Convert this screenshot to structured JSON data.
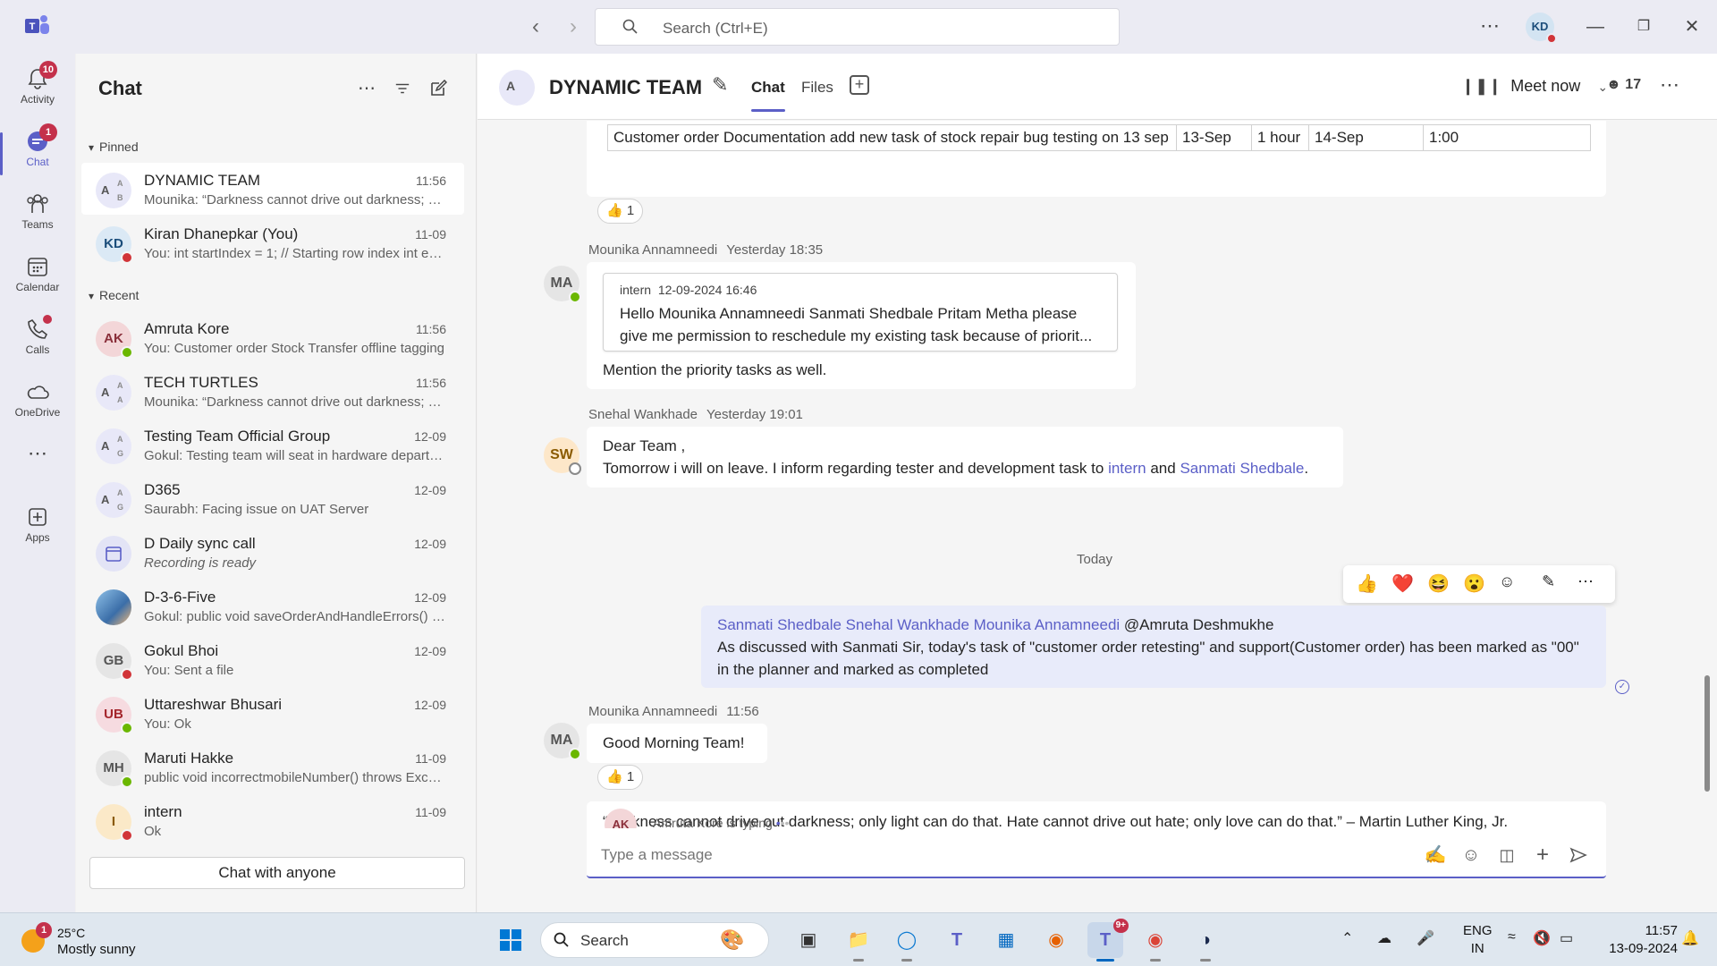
{
  "titlebar": {
    "search_placeholder": "Search (Ctrl+E)",
    "user_initials": "KD",
    "more_label": "⋯"
  },
  "rail": {
    "items": [
      {
        "label": "Activity",
        "badge": "10"
      },
      {
        "label": "Chat",
        "badge": "1"
      },
      {
        "label": "Teams"
      },
      {
        "label": "Calendar"
      },
      {
        "label": "Calls"
      },
      {
        "label": "OneDrive"
      },
      {
        "label": "Apps"
      }
    ]
  },
  "chatlist": {
    "title": "Chat",
    "pinned_label": "Pinned",
    "recent_label": "Recent",
    "chat_with_anyone": "Chat with anyone",
    "pinned": [
      {
        "name": "DYNAMIC TEAM",
        "time": "11:56",
        "preview": "Mounika: “Darkness cannot drive out darkness; only light can do that.",
        "initials": "A"
      },
      {
        "name": "Kiran Dhanepkar (You)",
        "time": "11-09",
        "preview": "You: int startIndex = 1; // Starting row index int endIndex",
        "initials": "KD"
      }
    ],
    "recent": [
      {
        "name": "Amruta Kore",
        "time": "11:56",
        "preview": "You: Customer order Stock Transfer offline tagging",
        "initials": "AK"
      },
      {
        "name": "TECH TURTLES",
        "time": "11:56",
        "preview": "Mounika: “Darkness cannot drive out darkness; only light",
        "initials": "A"
      },
      {
        "name": "Testing Team Official Group",
        "time": "12-09",
        "preview": "Gokul: Testing team will seat in hardware department",
        "initials": "A"
      },
      {
        "name": "D365",
        "time": "12-09",
        "preview": "Saurabh: Facing issue on UAT Server",
        "initials": "A"
      },
      {
        "name": "D Daily sync call",
        "time": "12-09",
        "preview": "Recording is ready"
      },
      {
        "name": "D-3-6-Five",
        "time": "12-09",
        "preview": "Gokul: public void saveOrderAndHandleErrors() throws"
      },
      {
        "name": "Gokul Bhoi",
        "time": "12-09",
        "preview": "You: Sent a file",
        "initials": "GB"
      },
      {
        "name": "Uttareshwar Bhusari",
        "time": "12-09",
        "preview": "You: Ok",
        "initials": "UB"
      },
      {
        "name": "Maruti Hakke",
        "time": "11-09",
        "preview": "public void incorrectmobileNumber() throws Exception",
        "initials": "MH"
      },
      {
        "name": "intern",
        "time": "11-09",
        "preview": "Ok",
        "initials": "I"
      }
    ]
  },
  "header": {
    "title": "DYNAMIC TEAM",
    "avatar_initials": "A",
    "tabs": [
      "Chat",
      "Files"
    ],
    "meet_now": "Meet now",
    "participants": "17"
  },
  "messages": {
    "table_row": [
      "Customer order Documentation add new task of stock repair bug testing on 13 sep",
      "13-Sep",
      "1 hour",
      "14-Sep",
      "1:00"
    ],
    "reaction1": "1",
    "m1": {
      "author": "Mounika Annamneedi",
      "time": "Yesterday 18:35",
      "initials": "MA",
      "quote_author": "intern",
      "quote_time": "12-09-2024 16:46",
      "quote_text": "Hello Mounika Annamneedi Sanmati Shedbale Pritam Metha please give me permission to reschedule my existing task because of priorit...",
      "text": "Mention the priority tasks as well."
    },
    "m2": {
      "author": "Snehal Wankhade",
      "time": "Yesterday 19:01",
      "initials": "SW",
      "line1": "Dear Team ,",
      "line2_a": "Tomorrow i will on leave. I inform regarding tester and development task to",
      "mention1": "intern",
      "and": "and",
      "mention2": "Sanmati Shedbale",
      "period": "."
    },
    "today": "Today",
    "m3": {
      "mentions": "Sanmati Shedbale Snehal Wankhade Mounika Annamneedi",
      "at": "@Amruta Deshmukhe",
      "text": "As discussed with Sanmati Sir, today's task of \"customer order retesting\" and support(Customer order) has been marked as \"00\" in the planner and marked as completed"
    },
    "m4": {
      "author": "Mounika Annamneedi",
      "time": "11:56",
      "initials": "MA",
      "text": "Good Morning Team!",
      "reaction": "1",
      "quote": "“Darkness cannot drive out darkness; only light can do that. Hate cannot drive out hate; only love can do that.” – Martin Luther King, Jr."
    },
    "typing": {
      "initials": "AK",
      "text": "Amruta Kore is typing"
    }
  },
  "compose": {
    "placeholder": "Type a message"
  },
  "taskbar": {
    "weather_temp": "25°C",
    "weather_desc": "Mostly sunny",
    "weather_badge": "1",
    "search_label": "Search",
    "teams_badge": "9+",
    "lang1": "ENG",
    "lang2": "IN",
    "time": "11:57",
    "date": "13-09-2024"
  },
  "colors": {
    "accent": "#5b5fc7",
    "badge": "#c4314b",
    "online": "#6bb700",
    "busy": "#d13438"
  }
}
